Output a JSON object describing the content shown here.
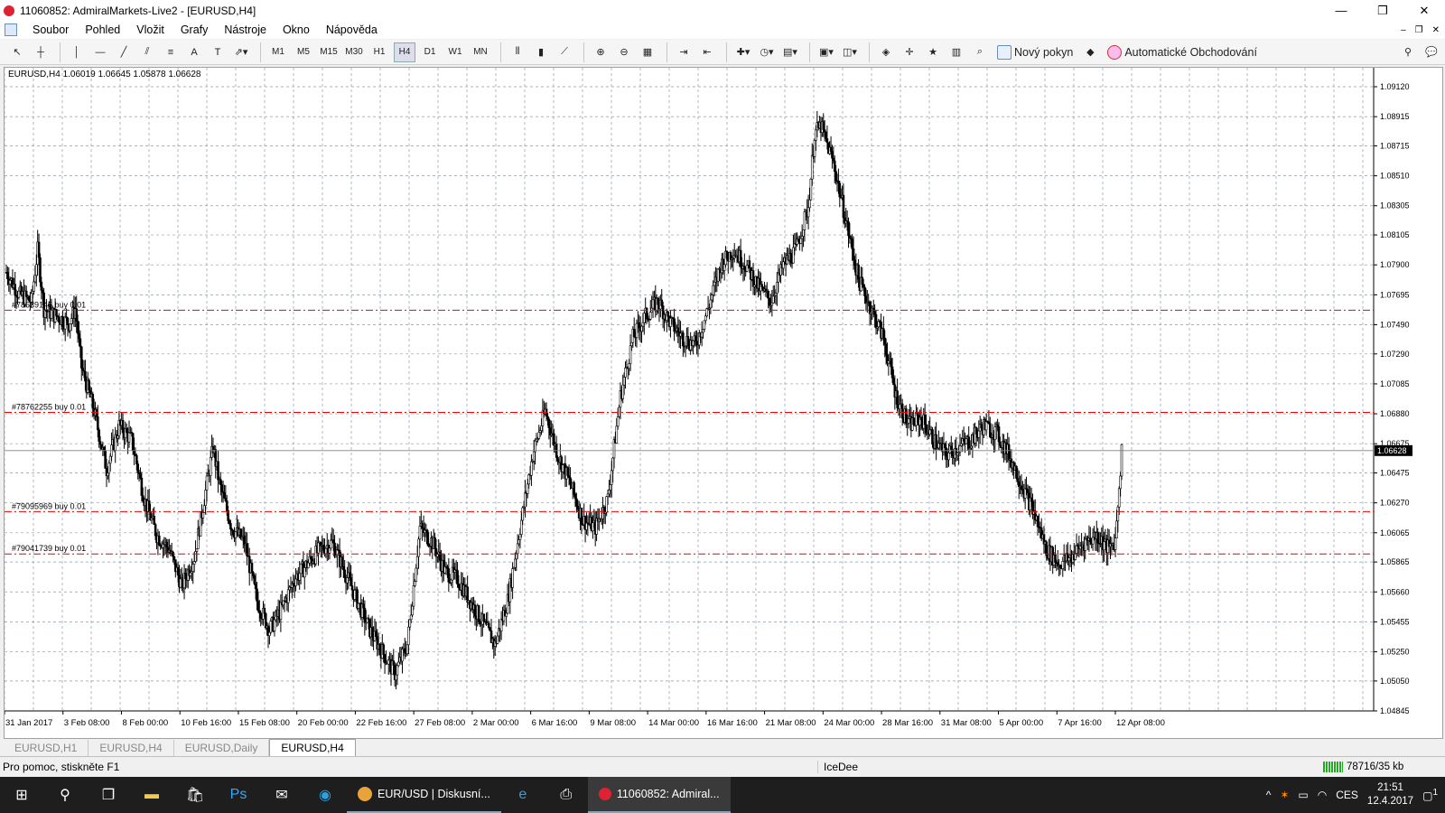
{
  "window": {
    "title": "11060852: AdmiralMarkets-Live2 - [EURUSD,H4]",
    "min": "—",
    "restore": "❐",
    "close": "✕"
  },
  "menu": [
    "Soubor",
    "Pohled",
    "Vložit",
    "Grafy",
    "Nástroje",
    "Okno",
    "Nápověda"
  ],
  "toolbar": {
    "timeframes": [
      "M1",
      "M5",
      "M15",
      "M30",
      "H1",
      "H4",
      "D1",
      "W1",
      "MN"
    ],
    "active_timeframe": "H4",
    "new_order": "Nový pokyn",
    "auto_trading": "Automatické Obchodování"
  },
  "chart_data": {
    "type": "candlestick",
    "symbol_header": "EURUSD,H4  1.06019 1.06645 1.05878 1.06628",
    "current_price": "1.06628",
    "ylim": [
      1.04845,
      1.0925
    ],
    "y_ticks": [
      "1.09120",
      "1.08915",
      "1.08715",
      "1.08510",
      "1.08305",
      "1.08105",
      "1.07900",
      "1.07695",
      "1.07490",
      "1.07290",
      "1.07085",
      "1.06880",
      "1.06675",
      "1.06475",
      "1.06270",
      "1.06065",
      "1.05865",
      "1.05660",
      "1.05455",
      "1.05250",
      "1.05050",
      "1.04845"
    ],
    "x_ticks": [
      "31 Jan 2017",
      "3 Feb 08:00",
      "8 Feb 00:00",
      "10 Feb 16:00",
      "15 Feb 08:00",
      "20 Feb 00:00",
      "22 Feb 16:00",
      "27 Feb 08:00",
      "2 Mar 00:00",
      "6 Mar 16:00",
      "9 Mar 08:00",
      "14 Mar 00:00",
      "16 Mar 16:00",
      "21 Mar 08:00",
      "24 Mar 00:00",
      "28 Mar 16:00",
      "31 Mar 08:00",
      "5 Apr 00:00",
      "7 Apr 16:00",
      "12 Apr 08:00"
    ],
    "order_lines": [
      {
        "label": "#78639140 buy 0.01",
        "price": 1.0759
      },
      {
        "label": "#78762255 buy 0.01",
        "price": 1.0689
      },
      {
        "label": "#79095969 buy 0.01",
        "price": 1.0621
      },
      {
        "label": "#79041739 buy 0.01",
        "price": 1.0592
      }
    ],
    "close_path": [
      [
        0,
        1.0785
      ],
      [
        10,
        1.077
      ],
      [
        20,
        1.0765
      ],
      [
        25,
        1.08
      ],
      [
        30,
        1.076
      ],
      [
        40,
        1.0755
      ],
      [
        50,
        1.075
      ],
      [
        55,
        1.076
      ],
      [
        60,
        1.072
      ],
      [
        70,
        1.069
      ],
      [
        80,
        1.065
      ],
      [
        90,
        1.068
      ],
      [
        100,
        1.067
      ],
      [
        105,
        1.065
      ],
      [
        110,
        1.063
      ],
      [
        120,
        1.0605
      ],
      [
        130,
        1.0595
      ],
      [
        140,
        1.057
      ],
      [
        150,
        1.059
      ],
      [
        160,
        1.064
      ],
      [
        165,
        1.0665
      ],
      [
        170,
        1.064
      ],
      [
        180,
        1.061
      ],
      [
        190,
        1.06
      ],
      [
        200,
        1.056
      ],
      [
        210,
        1.054
      ],
      [
        220,
        1.0555
      ],
      [
        230,
        1.0575
      ],
      [
        240,
        1.0585
      ],
      [
        250,
        1.0595
      ],
      [
        260,
        1.06
      ],
      [
        270,
        1.058
      ],
      [
        280,
        1.056
      ],
      [
        290,
        1.054
      ],
      [
        300,
        1.0525
      ],
      [
        310,
        1.051
      ],
      [
        320,
        1.053
      ],
      [
        330,
        1.061
      ],
      [
        340,
        1.06
      ],
      [
        350,
        1.058
      ],
      [
        360,
        1.0575
      ],
      [
        370,
        1.056
      ],
      [
        380,
        1.0545
      ],
      [
        390,
        1.053
      ],
      [
        400,
        1.056
      ],
      [
        410,
        1.061
      ],
      [
        420,
        1.066
      ],
      [
        430,
        1.069
      ],
      [
        440,
        1.066
      ],
      [
        450,
        1.064
      ],
      [
        460,
        1.0615
      ],
      [
        470,
        1.061
      ],
      [
        480,
        1.063
      ],
      [
        490,
        1.07
      ],
      [
        500,
        1.074
      ],
      [
        510,
        1.0755
      ],
      [
        520,
        1.0765
      ],
      [
        530,
        1.075
      ],
      [
        540,
        1.074
      ],
      [
        550,
        1.0735
      ],
      [
        560,
        1.076
      ],
      [
        570,
        1.079
      ],
      [
        580,
        1.08
      ],
      [
        590,
        1.079
      ],
      [
        600,
        1.0775
      ],
      [
        610,
        1.0765
      ],
      [
        620,
        1.079
      ],
      [
        630,
        1.08
      ],
      [
        640,
        1.083
      ],
      [
        645,
        1.088
      ],
      [
        650,
        1.0885
      ],
      [
        660,
        1.086
      ],
      [
        670,
        1.082
      ],
      [
        680,
        1.078
      ],
      [
        690,
        1.076
      ],
      [
        700,
        1.074
      ],
      [
        710,
        1.07
      ],
      [
        720,
        1.068
      ],
      [
        730,
        1.0685
      ],
      [
        740,
        1.067
      ],
      [
        750,
        1.066
      ],
      [
        760,
        1.0665
      ],
      [
        770,
        1.067
      ],
      [
        780,
        1.068
      ],
      [
        790,
        1.0675
      ],
      [
        800,
        1.066
      ],
      [
        810,
        1.064
      ],
      [
        820,
        1.062
      ],
      [
        830,
        1.0595
      ],
      [
        840,
        1.0585
      ],
      [
        850,
        1.059
      ],
      [
        860,
        1.06
      ],
      [
        870,
        1.0605
      ],
      [
        880,
        1.0595
      ],
      [
        885,
        1.0602
      ],
      [
        890,
        1.0663
      ]
    ]
  },
  "tabs": [
    "EURUSD,H1",
    "EURUSD,H4",
    "EURUSD,Daily",
    "EURUSD,H4"
  ],
  "active_tab_index": 3,
  "status": {
    "help": "Pro pomoc, stiskněte F1",
    "user": "IceDee",
    "traffic": "78716/35 kb"
  },
  "taskbar": {
    "apps": [
      {
        "label": "EUR/USD | Diskusní...",
        "icon": "chrome-icon",
        "color": "#e8a33a"
      },
      {
        "label": "11060852: Admiral...",
        "icon": "metatrader-icon",
        "color": "#d23"
      }
    ],
    "lang": "CES",
    "time": "21:51",
    "date": "12.4.2017",
    "notif": "1"
  }
}
